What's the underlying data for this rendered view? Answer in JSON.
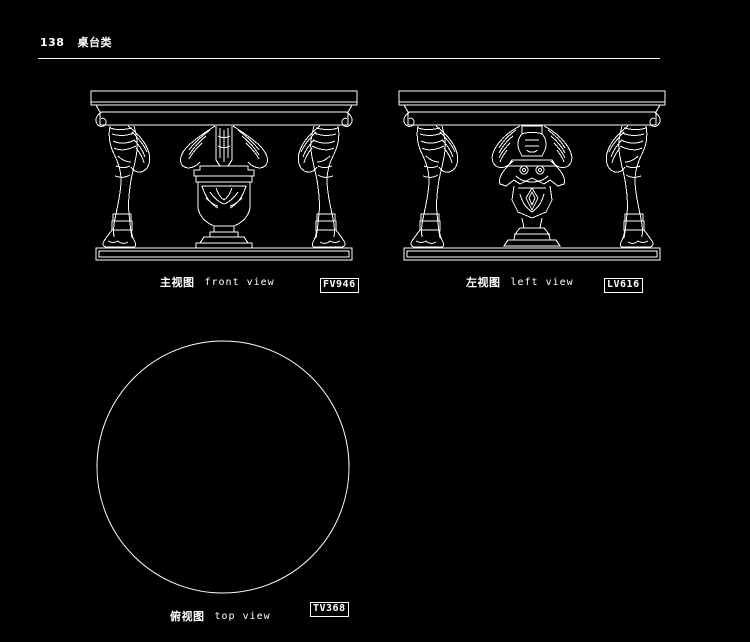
{
  "page": {
    "background_color": "#000000",
    "ink_color": "#ffffff",
    "header_number": "138",
    "header_category_cn": "桌台类",
    "header_text": "138   桌台类"
  },
  "views": [
    {
      "id": "front-view",
      "label_cn": "主视图",
      "label_en": "front view",
      "code": "FV946"
    },
    {
      "id": "left-view",
      "label_cn": "左视图",
      "label_en": "left view",
      "code": "LV616"
    },
    {
      "id": "top-view",
      "label_cn": "俯视图",
      "label_en": "top view",
      "code": "TV368"
    }
  ],
  "drawing": {
    "subject": "classical console table with winged griffin figure supports and central urn pedestal",
    "top_view_shape": "circle",
    "line_color": "#ffffff"
  }
}
